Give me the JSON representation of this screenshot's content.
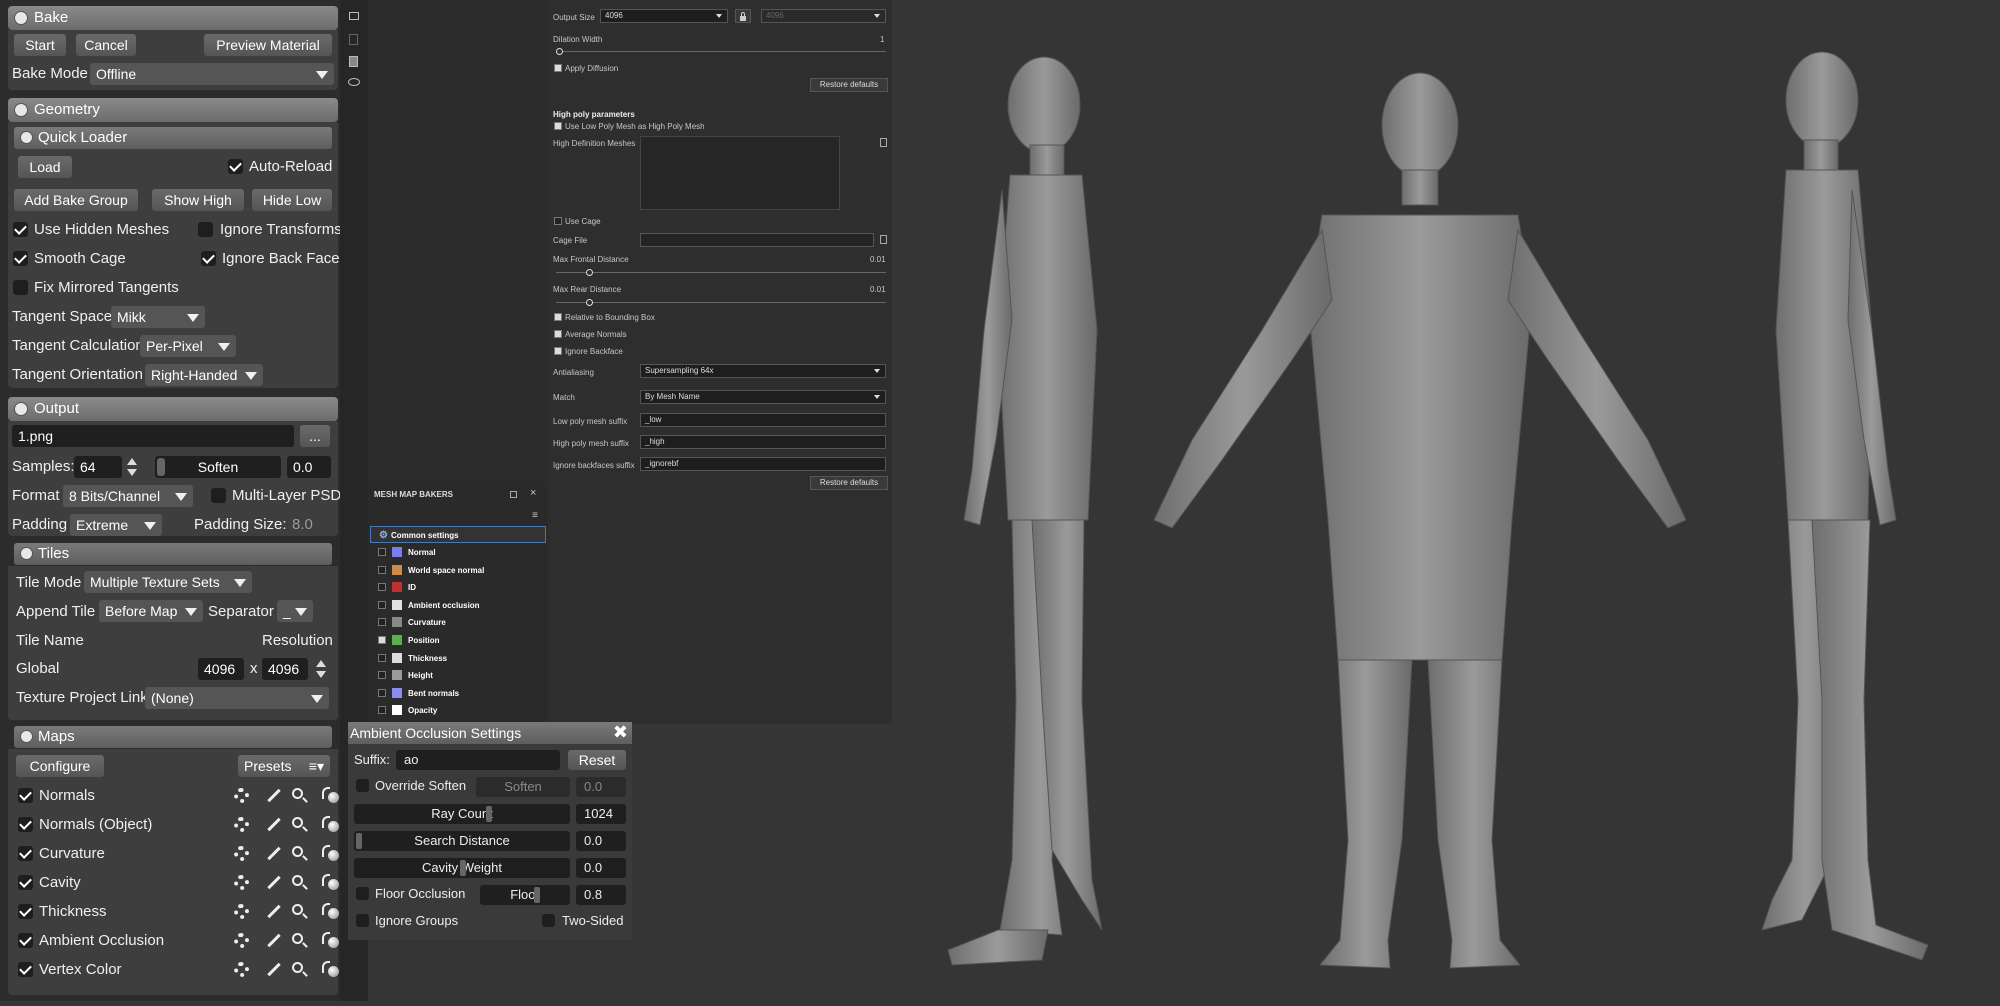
{
  "bake": {
    "header": "Bake",
    "start": "Start",
    "cancel": "Cancel",
    "preview": "Preview Material",
    "mode_label": "Bake Mode",
    "mode_value": "Offline"
  },
  "geometry": {
    "header": "Geometry",
    "quick_loader": "Quick Loader",
    "load": "Load",
    "auto_reload": "Auto-Reload",
    "add_bake_group": "Add Bake Group",
    "show_high": "Show High",
    "hide_low": "Hide Low",
    "use_hidden_meshes": "Use Hidden Meshes",
    "ignore_transforms": "Ignore Transforms",
    "smooth_cage": "Smooth Cage",
    "ignore_back_faces": "Ignore Back Faces",
    "fix_mirrored": "Fix Mirrored Tangents",
    "tangent_space_label": "Tangent Space",
    "tangent_space_value": "Mikk",
    "tangent_calc_label": "Tangent Calculation",
    "tangent_calc_value": "Per-Pixel",
    "tangent_orient_label": "Tangent Orientation",
    "tangent_orient_value": "Right-Handed"
  },
  "output": {
    "header": "Output",
    "file": "1.png",
    "browse": "...",
    "samples_label": "Samples:",
    "samples_value": "64",
    "soften_label": "Soften",
    "soften_value": "0.0",
    "format_label": "Format",
    "format_value": "8 Bits/Channel",
    "multilayer": "Multi-Layer PSD",
    "padding_label": "Padding",
    "padding_value": "Extreme",
    "padding_size_label": "Padding Size:",
    "padding_size_value": "8.0"
  },
  "tiles": {
    "header": "Tiles",
    "mode_label": "Tile Mode",
    "mode_value": "Multiple Texture Sets",
    "append_label": "Append Tile",
    "append_value": "Before Map",
    "separator_label": "Separator",
    "separator_value": "_",
    "name_label": "Tile Name",
    "resolution_label": "Resolution",
    "global_label": "Global",
    "res_w": "4096",
    "res_x": "x",
    "res_h": "4096",
    "project_link_label": "Texture Project Link",
    "project_link_value": "(None)"
  },
  "maps": {
    "header": "Maps",
    "configure": "Configure",
    "presets": "Presets",
    "items": [
      "Normals",
      "Normals (Object)",
      "Curvature",
      "Cavity",
      "Thickness",
      "Ambient Occlusion",
      "Vertex Color"
    ]
  },
  "substance": {
    "output_size_label": "Output Size",
    "output_size_value": "4096",
    "output_size_locked": "4096",
    "dilation_label": "Dilation Width",
    "dilation_value": "1",
    "apply_diffusion": "Apply Diffusion",
    "restore_defaults": "Restore defaults",
    "high_poly_header": "High poly parameters",
    "use_low_as_high": "Use Low Poly Mesh as High Poly Mesh",
    "hd_meshes": "High Definition Meshes",
    "use_cage": "Use Cage",
    "cage_file": "Cage File",
    "max_frontal": "Max Frontal Distance",
    "max_frontal_value": "0.01",
    "max_rear": "Max Rear Distance",
    "max_rear_value": "0.01",
    "relative_bbox": "Relative to Bounding Box",
    "average_normals": "Average Normals",
    "ignore_backface": "Ignore Backface",
    "antialiasing_label": "Antialiasing",
    "antialiasing_value": "Supersampling 64x",
    "match_label": "Match",
    "match_value": "By Mesh Name",
    "low_suffix_label": "Low poly mesh suffix",
    "low_suffix_value": "_low",
    "high_suffix_label": "High poly mesh suffix",
    "high_suffix_value": "_high",
    "ignore_suffix_label": "Ignore backfaces suffix",
    "ignore_suffix_value": "_ignorebf",
    "restore_defaults_2": "Restore defaults"
  },
  "bakers": {
    "title": "MESH MAP BAKERS",
    "common": "Common settings",
    "items": [
      {
        "label": "Normal",
        "checked": false,
        "color": "#7a7cf0"
      },
      {
        "label": "World space normal",
        "checked": false,
        "color": "#d08a4a"
      },
      {
        "label": "ID",
        "checked": false,
        "color": "#c03030"
      },
      {
        "label": "Ambient occlusion",
        "checked": false,
        "color": "#e0e0e0"
      },
      {
        "label": "Curvature",
        "checked": false,
        "color": "#888888"
      },
      {
        "label": "Position",
        "checked": true,
        "color": "#5ab04a"
      },
      {
        "label": "Thickness",
        "checked": false,
        "color": "#dddddd"
      },
      {
        "label": "Height",
        "checked": false,
        "color": "#9a9a9a"
      },
      {
        "label": "Bent normals",
        "checked": false,
        "color": "#8a8cf0"
      },
      {
        "label": "Opacity",
        "checked": false,
        "color": "#ffffff"
      }
    ]
  },
  "ao": {
    "title": "Ambient Occlusion Settings",
    "suffix_label": "Suffix:",
    "suffix_value": "ao",
    "reset": "Reset",
    "override_soften": "Override Soften",
    "soften": "Soften",
    "soften_value": "0.0",
    "ray_count": "Ray Count",
    "ray_count_value": "1024",
    "search_distance": "Search Distance",
    "search_distance_value": "0.0",
    "cavity_weight": "Cavity Weight",
    "cavity_weight_value": "0.0",
    "floor_occlusion": "Floor Occlusion",
    "floor": "Floor",
    "floor_value": "0.8",
    "ignore_groups": "Ignore Groups",
    "two_sided": "Two-Sided"
  }
}
